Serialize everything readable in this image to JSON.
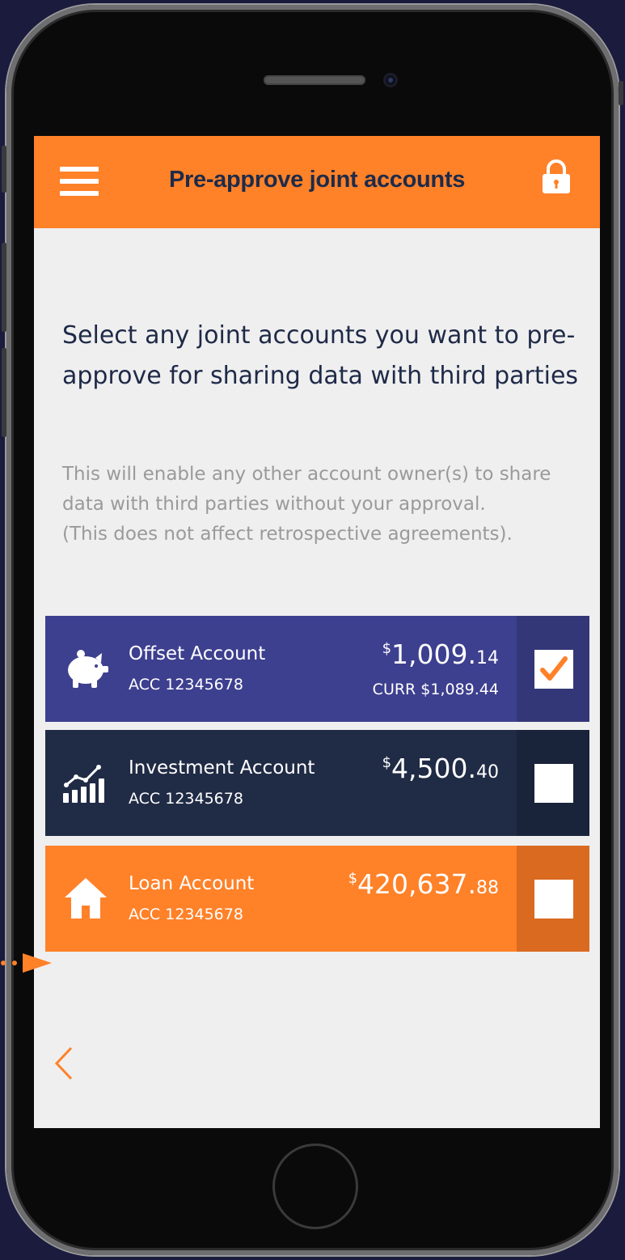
{
  "colors": {
    "accent": "#ff8128",
    "navy": "#1e2b4a",
    "offset_bg": "#3d3f8f",
    "offset_chk_bg": "#333778",
    "investment_bg": "#202b45",
    "investment_chk_bg": "#19233a",
    "loan_bg": "#ff8128",
    "loan_chk_bg": "#d96a20"
  },
  "header": {
    "title": "Pre-approve joint accounts",
    "menu_icon": "hamburger-menu-icon",
    "lock_icon": "lock-icon"
  },
  "main": {
    "heading": "Select any joint accounts you want to pre-approve for sharing data with third parties",
    "description_lines": [
      "This will enable any other account owner(s) to share",
      "data with third parties without your approval.",
      "(This does not affect retrospective agreements)."
    ]
  },
  "accounts": [
    {
      "name": "Offset Account",
      "number": "ACC 12345678",
      "currency_symbol": "$",
      "balance_main": "1,009.",
      "balance_cents": "14",
      "current_balance": "CURR $1,089.44",
      "checked": true,
      "icon": "piggy-bank-icon"
    },
    {
      "name": "Investment Account",
      "number": "ACC 12345678",
      "currency_symbol": "$",
      "balance_main": "4,500.",
      "balance_cents": "40",
      "checked": false,
      "icon": "growth-chart-icon"
    },
    {
      "name": "Loan Account",
      "number": "ACC 12345678",
      "currency_symbol": "$",
      "balance_main": "420,637.",
      "balance_cents": "88",
      "checked": false,
      "icon": "house-icon"
    }
  ],
  "footer": {
    "back_icon": "chevron-left-icon"
  }
}
